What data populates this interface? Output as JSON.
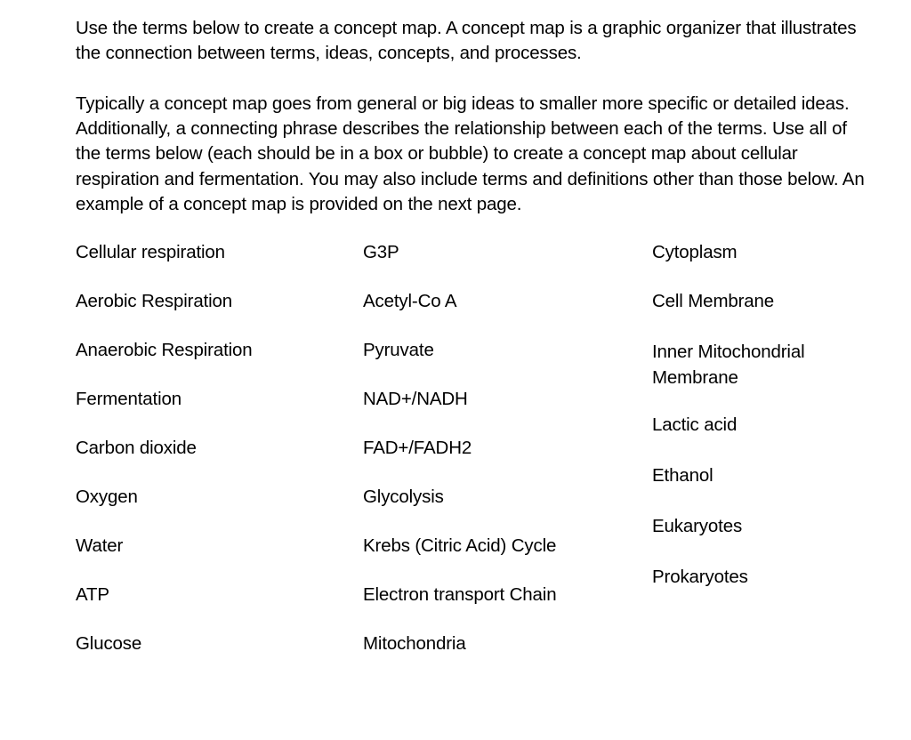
{
  "document": {
    "background_color": "#ffffff",
    "text_color": "#000000"
  },
  "instructions": {
    "paragraph_1": "Use the terms below to create a concept map. A concept map is a graphic organizer that illustrates the connection between terms, ideas, concepts, and processes.",
    "paragraph_2": "Typically a concept map goes from general or big ideas to smaller more specific or detailed ideas. Additionally, a connecting phrase describes the relationship between each of the terms. Use all of the terms below (each should be in a box or bubble) to create a concept map about cellular respiration and fermentation. You may also include terms and definitions other than those below. An example of a concept map is provided on the next page."
  },
  "term_columns": [
    {
      "id": "column-1",
      "terms": [
        "Cellular respiration",
        "Aerobic Respiration",
        "Anaerobic Respiration",
        "Fermentation",
        "Carbon dioxide",
        "Oxygen",
        "Water",
        "ATP",
        "Glucose"
      ]
    },
    {
      "id": "column-2",
      "terms": [
        "G3P",
        "Acetyl-Co A",
        "Pyruvate",
        "NAD+/NADH",
        "FAD+/FADH2",
        "Glycolysis",
        "Krebs (Citric Acid) Cycle",
        "Electron transport Chain",
        "Mitochondria"
      ]
    },
    {
      "id": "column-3",
      "terms": [
        "Cytoplasm",
        "Cell Membrane",
        "Inner Mitochondrial Membrane",
        "Lactic acid",
        "Ethanol",
        "Eukaryotes",
        "Prokaryotes"
      ]
    }
  ]
}
